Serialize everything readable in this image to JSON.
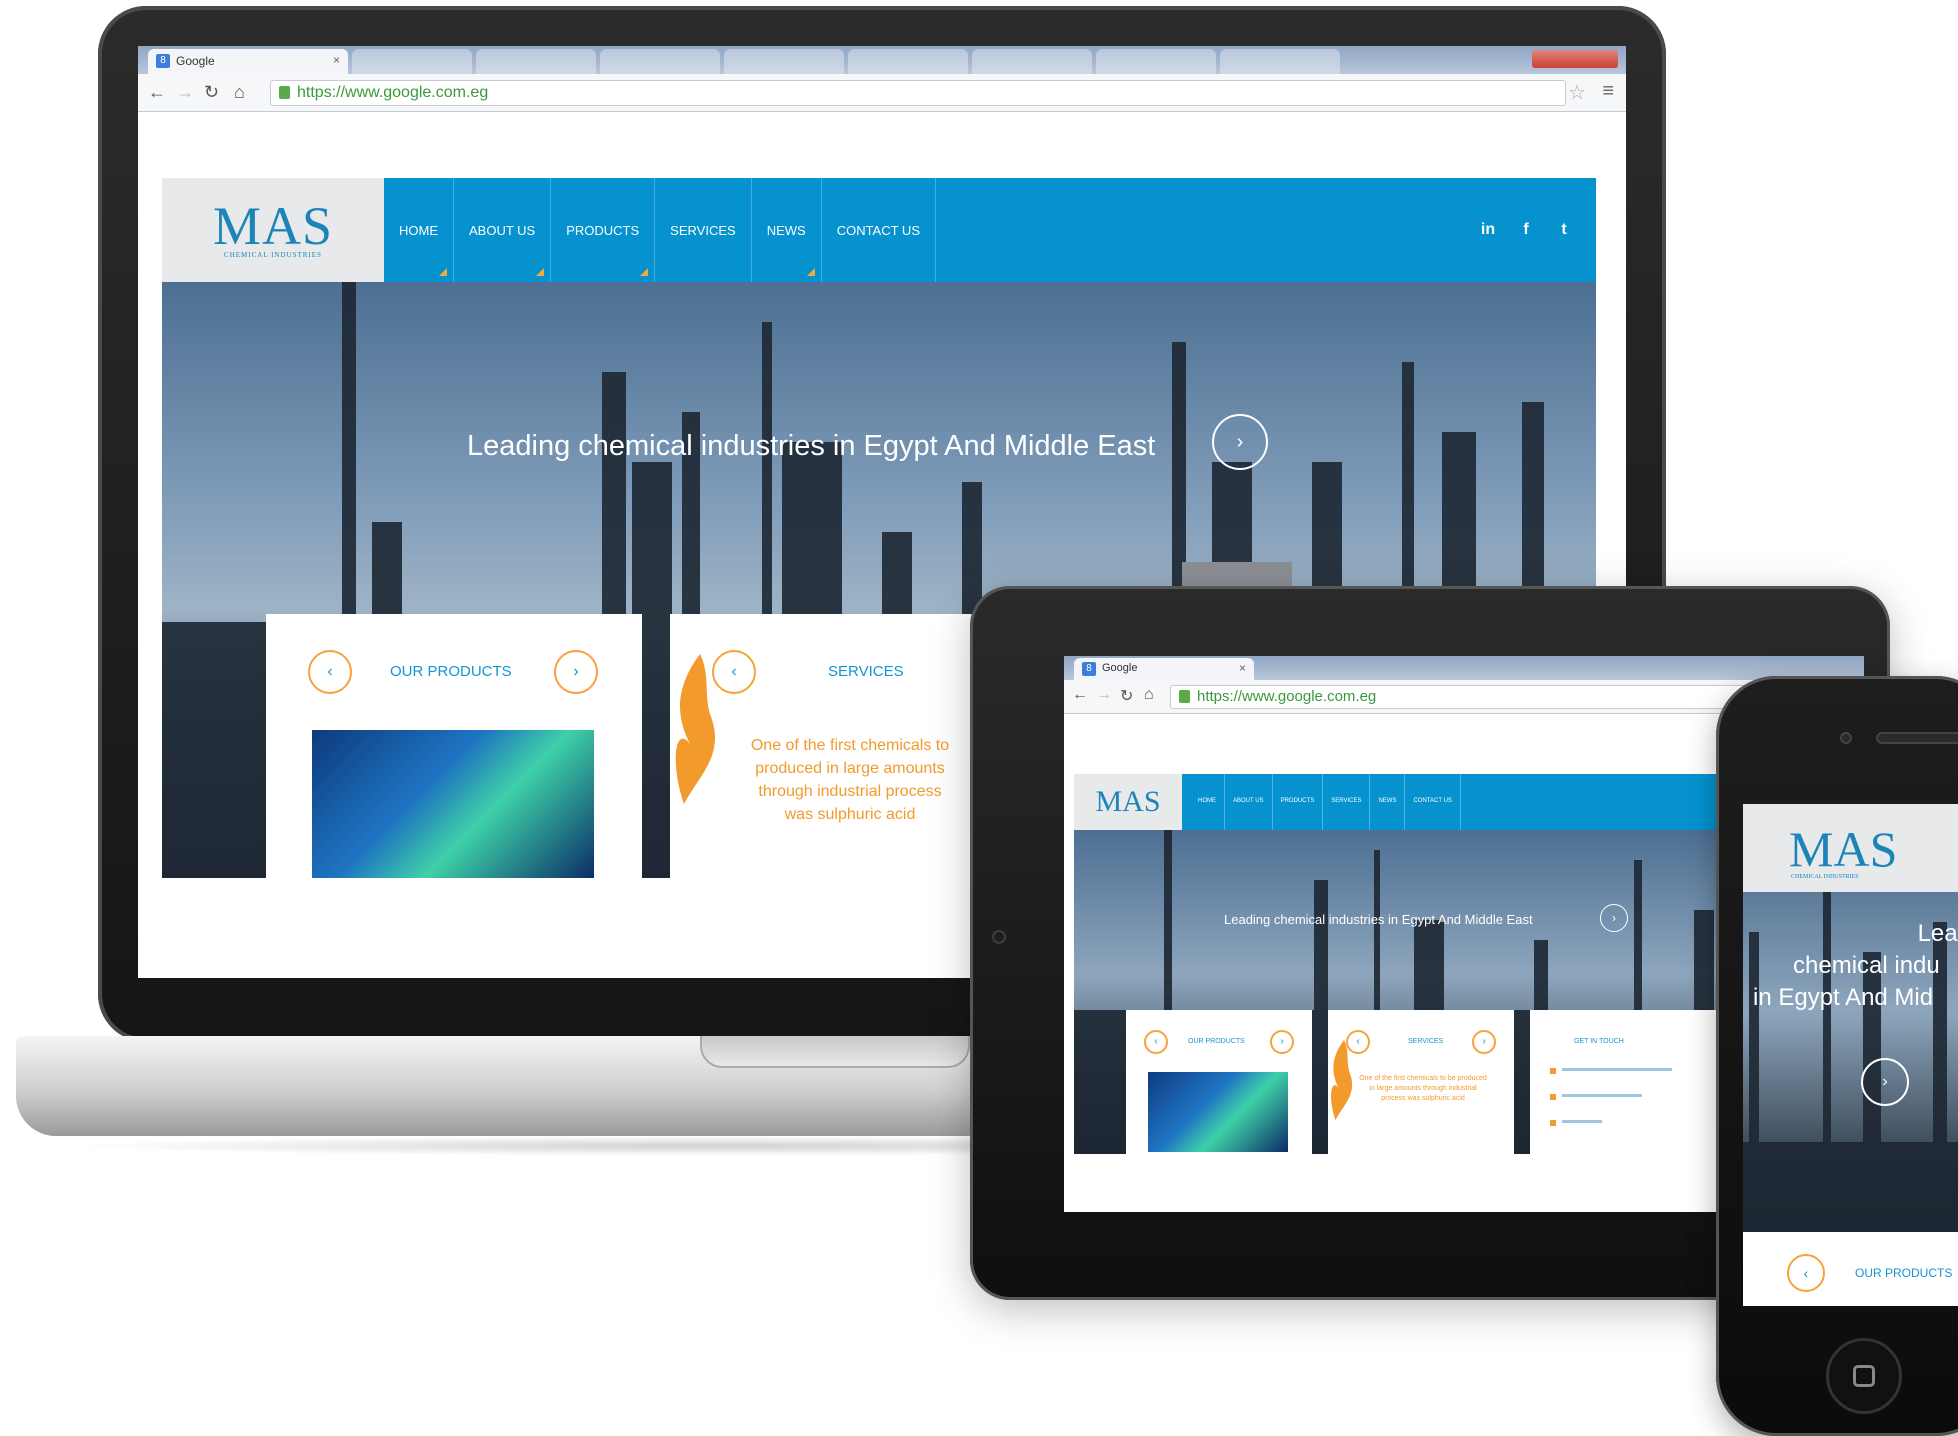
{
  "browser": {
    "tab_title": "Google",
    "tab_close": "×",
    "url": "https://www.google.com.eg",
    "favicon_letter": "8"
  },
  "site": {
    "logo": "MAS",
    "logo_sub": "CHEMICAL INDUSTRIES",
    "nav": [
      "HOME",
      "ABOUT US",
      "PRODUCTS",
      "SERVICES",
      "NEWS",
      "CONTACT US"
    ],
    "social": [
      "in",
      "f",
      "t"
    ],
    "hero_title": "Leading chemical industries in Egypt And Middle East",
    "hero_next": "›",
    "prev_glyph": "‹",
    "next_glyph": "›",
    "products_title": "OUR PRODUCTS",
    "services_title": "SERVICES",
    "services_text": "One of the first chemicals to be produced in large amounts through industrial process was sulphuric acid",
    "services_text_laptop": [
      "One of the first chemicals to",
      "produced in large amounts",
      "through industrial process",
      "was sulphuric acid"
    ],
    "contact_title": "GET IN TOUCH",
    "phone_hero": [
      "Leading",
      "chemical indu",
      "in Egypt And Mid"
    ]
  },
  "colors": {
    "brand_blue": "#0592cf",
    "accent_orange": "#f39a2c"
  }
}
